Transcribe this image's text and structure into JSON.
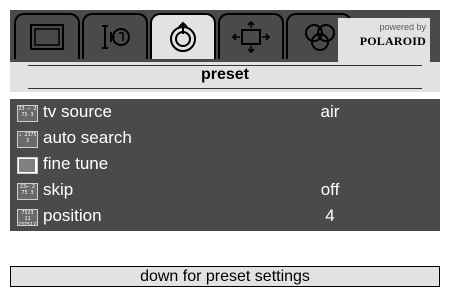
{
  "tabs": [
    {
      "icon": "picture-icon"
    },
    {
      "icon": "sound-icon"
    },
    {
      "icon": "preset-icon",
      "active": true
    },
    {
      "icon": "geometry-icon"
    },
    {
      "icon": "features-icon"
    }
  ],
  "brand": {
    "powered_by": "powered by",
    "logo": "POLAROID"
  },
  "menu": {
    "title": "preset"
  },
  "rows": [
    {
      "label": "tv source",
      "value": "air",
      "icon": "tv-source-icon",
      "icon_text": "23 ⇐ 2 75 3"
    },
    {
      "label": "auto search",
      "value": "",
      "icon": "auto-search-icon",
      "icon_text": "↓ 2375 3"
    },
    {
      "label": "fine tune",
      "value": "",
      "icon": "fine-tune-icon",
      "icon_text": ""
    },
    {
      "label": "skip",
      "value": "off",
      "icon": "skip-icon",
      "icon_text": "23⇐ 2 75 3"
    },
    {
      "label": "position",
      "value": "4",
      "icon": "position-icon",
      "icon_text": "7523 11 2375123"
    }
  ],
  "hint": "down for preset settings",
  "colors": {
    "panel": "#4a4a4a",
    "light": "#e2e2e2",
    "text": "#ffffff"
  }
}
